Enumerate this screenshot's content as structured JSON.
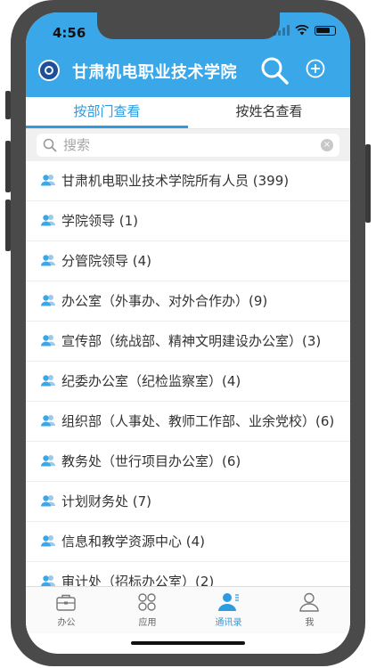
{
  "status": {
    "time": "4:56"
  },
  "app": {
    "title": "甘肃机电职业技术学院"
  },
  "tabs": [
    {
      "label": "按部门查看",
      "active": true
    },
    {
      "label": "按姓名查看",
      "active": false
    }
  ],
  "search": {
    "placeholder": "搜索"
  },
  "departments": [
    {
      "label": "甘肃机电职业技术学院所有人员 (399)"
    },
    {
      "label": "学院领导 (1)"
    },
    {
      "label": "分管院领导 (4)"
    },
    {
      "label": "办公室（外事办、对外合作办）(9)"
    },
    {
      "label": "宣传部（统战部、精神文明建设办公室）(3)"
    },
    {
      "label": "纪委办公室（纪检监察室）(4)"
    },
    {
      "label": "组织部（人事处、教师工作部、业余党校）(6)"
    },
    {
      "label": "教务处（世行项目办公室）(6)"
    },
    {
      "label": "计划财务处 (7)"
    },
    {
      "label": "信息和教学资源中心 (4)"
    },
    {
      "label": "审计处（招标办公室）(2)"
    }
  ],
  "tabbar": [
    {
      "label": "办公",
      "icon": "briefcase-icon",
      "active": false
    },
    {
      "label": "应用",
      "icon": "apps-icon",
      "active": false
    },
    {
      "label": "通讯录",
      "icon": "contacts-icon",
      "active": true
    },
    {
      "label": "我",
      "icon": "person-icon",
      "active": false
    }
  ],
  "colors": {
    "accent": "#3aa8e8",
    "active_tab": "#2e9be0",
    "frame": "#4a4a4a"
  }
}
